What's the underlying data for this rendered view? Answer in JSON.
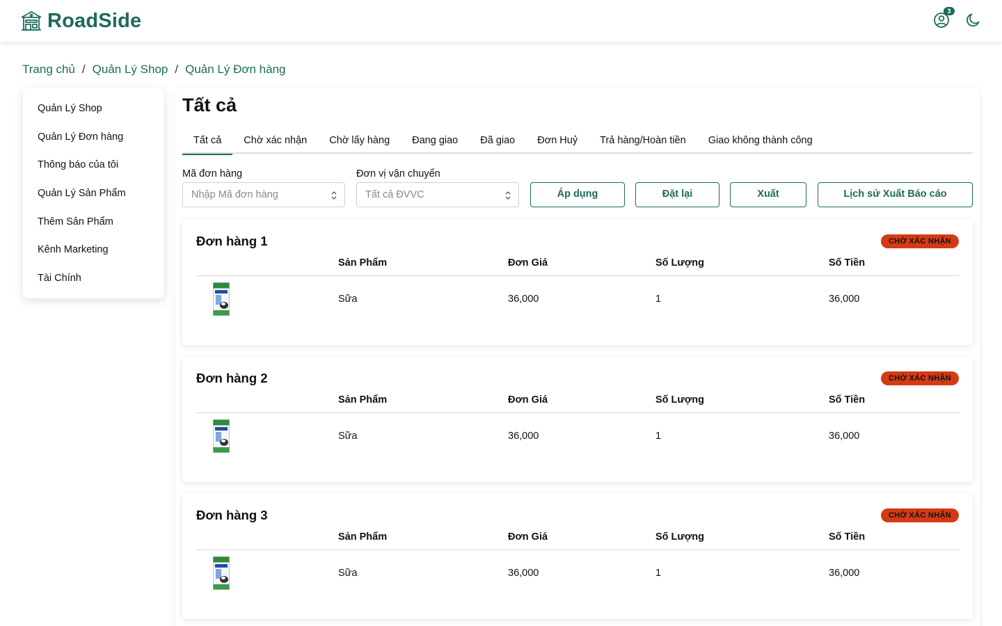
{
  "header": {
    "brand_name": "RoadSide",
    "logo_icon": "shop-house-icon",
    "notification_count": "3",
    "brand_color": "#1c6b5a"
  },
  "breadcrumb": [
    "Trang chủ",
    "Quản Lý Shop",
    "Quản Lý Đơn hàng"
  ],
  "sidebar": {
    "items": [
      {
        "label": "Quản Lý Shop"
      },
      {
        "label": "Quản Lý Đơn hàng"
      },
      {
        "label": "Thông báo của tôi"
      },
      {
        "label": "Quản Lý Sản Phẩm"
      },
      {
        "label": "Thêm Sản Phẩm"
      },
      {
        "label": "Kênh Marketing"
      },
      {
        "label": "Tài Chính"
      }
    ]
  },
  "main": {
    "title": "Tất cả",
    "tabs": [
      {
        "label": "Tất cả",
        "active": true
      },
      {
        "label": "Chờ xác nhận"
      },
      {
        "label": "Chờ lấy hàng"
      },
      {
        "label": "Đang giao"
      },
      {
        "label": "Đã giao"
      },
      {
        "label": "Đơn Huỷ"
      },
      {
        "label": "Trả hàng/Hoàn tiền"
      },
      {
        "label": "Giao không thành công"
      }
    ],
    "filters": {
      "order_code_label": "Mã đơn hàng",
      "order_code_placeholder": "Nhập Mã đơn hàng",
      "carrier_label": "Đơn vị vận chuyển",
      "carrier_value": "Tất cả ĐVVC",
      "apply_label": "Áp dụng",
      "reset_label": "Đặt lại",
      "export_label": "Xuất",
      "history_label": "Lịch sử Xuất Báo cáo"
    },
    "columns": [
      "Sản Phẩm",
      "Đơn Giá",
      "Số Lượng",
      "Số Tiền"
    ],
    "status_color": "#d43a15",
    "orders": [
      {
        "title": "Đơn hàng 1",
        "status": "CHỜ XÁC NHẬN",
        "product": "Sữa",
        "unit_price": "36,000",
        "quantity": "1",
        "amount": "36,000"
      },
      {
        "title": "Đơn hàng 2",
        "status": "CHỜ XÁC NHẬN",
        "product": "Sữa",
        "unit_price": "36,000",
        "quantity": "1",
        "amount": "36,000"
      },
      {
        "title": "Đơn hàng 3",
        "status": "CHỜ XÁC NHẬN",
        "product": "Sữa",
        "unit_price": "36,000",
        "quantity": "1",
        "amount": "36,000"
      }
    ]
  }
}
